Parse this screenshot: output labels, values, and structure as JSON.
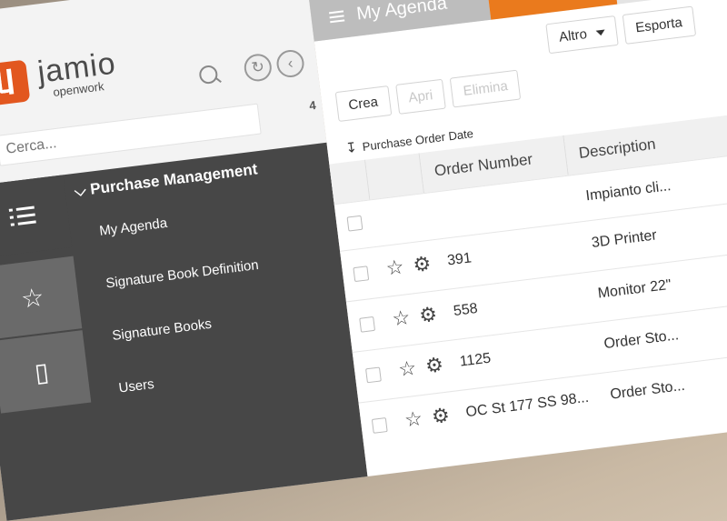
{
  "brand": {
    "name": "jamio",
    "sub": "openwork"
  },
  "sidebar": {
    "search_placeholder": "Cerca...",
    "count": "4",
    "section_title": "Purchase Management",
    "items": [
      {
        "label": "My Agenda"
      },
      {
        "label": "Signature Book Definition"
      },
      {
        "label": "Signature Books"
      },
      {
        "label": "Users"
      }
    ]
  },
  "tabs": {
    "active_label": "My Agenda"
  },
  "toolbar": {
    "altro_label": "Altro",
    "esporta_label": "Esporta",
    "crea_label": "Crea",
    "apri_label": "Apri",
    "elimina_label": "Elimina"
  },
  "sort": {
    "label": "Purchase Order Date"
  },
  "table": {
    "columns": [
      "Order Number",
      "Description"
    ],
    "rows": [
      {
        "number": "",
        "description": "Impianto cli..."
      },
      {
        "number": "391",
        "description": "3D Printer"
      },
      {
        "number": "558",
        "description": "Monitor 22\""
      },
      {
        "number": "1125",
        "description": "Order Sto..."
      },
      {
        "number": "OC St 177 SS 98...",
        "description": "Order Sto..."
      }
    ]
  },
  "colors": {
    "accent": "#ea7a1d",
    "menu_bg": "#474747",
    "logo": "#e2571f"
  }
}
